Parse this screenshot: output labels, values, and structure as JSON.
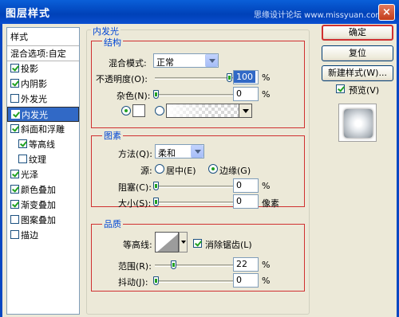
{
  "window": {
    "title": "图层样式",
    "watermark": "思缘设计论坛 www.missyuan.com",
    "close_label": "×"
  },
  "sidebar": {
    "header": "样式",
    "blend_options": "混合选项:自定",
    "items": [
      {
        "label": "投影",
        "checked": true
      },
      {
        "label": "内阴影",
        "checked": true
      },
      {
        "label": "外发光",
        "checked": false
      },
      {
        "label": "内发光",
        "checked": true,
        "selected": true
      },
      {
        "label": "斜面和浮雕",
        "checked": true
      },
      {
        "label": "等高线",
        "checked": true,
        "indent": true
      },
      {
        "label": "纹理",
        "checked": false,
        "indent": true
      },
      {
        "label": "光泽",
        "checked": true
      },
      {
        "label": "颜色叠加",
        "checked": true
      },
      {
        "label": "渐变叠加",
        "checked": true
      },
      {
        "label": "图案叠加",
        "checked": false
      },
      {
        "label": "描边",
        "checked": false
      }
    ]
  },
  "panel": {
    "title": "内发光",
    "structure": {
      "title": "结构",
      "blend_mode_label": "混合模式:",
      "blend_mode_value": "正常",
      "opacity_label": "不透明度(O):",
      "opacity_value": "100",
      "opacity_unit": "%",
      "noise_label": "杂色(N):",
      "noise_value": "0",
      "noise_unit": "%"
    },
    "elements": {
      "title": "图素",
      "method_label": "方法(Q):",
      "method_value": "柔和",
      "source_label": "源:",
      "source_center": "居中(E)",
      "source_edge": "边缘(G)",
      "choke_label": "阻塞(C):",
      "choke_value": "0",
      "choke_unit": "%",
      "size_label": "大小(S):",
      "size_value": "0",
      "size_unit": "像素"
    },
    "quality": {
      "title": "品质",
      "contour_label": "等高线:",
      "antialias_label": "消除锯齿(L)",
      "range_label": "范围(R):",
      "range_value": "22",
      "range_unit": "%",
      "jitter_label": "抖动(J):",
      "jitter_value": "0",
      "jitter_unit": "%"
    }
  },
  "buttons": {
    "ok": "确定",
    "reset": "复位",
    "new_style": "新建样式(W)...",
    "preview": "预览(V)"
  }
}
